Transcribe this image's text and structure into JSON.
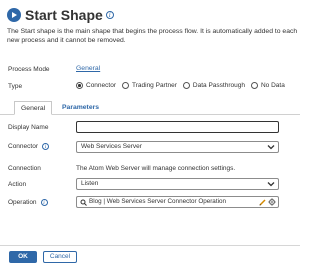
{
  "header": {
    "title": "Start Shape",
    "description_line1": "The Start shape is the main shape that begins the process flow. It is automatically added to each",
    "description_line2": "new process and it cannot be removed."
  },
  "process_mode": {
    "label": "Process Mode",
    "value": "General"
  },
  "type": {
    "label": "Type",
    "options": [
      "Connector",
      "Trading Partner",
      "Data Passthrough",
      "No Data"
    ],
    "selected": "Connector"
  },
  "tabs": [
    {
      "label": "General",
      "active": true
    },
    {
      "label": "Parameters",
      "active": false
    }
  ],
  "form": {
    "display_name": {
      "label": "Display Name",
      "value": ""
    },
    "connector": {
      "label": "Connector",
      "value": "Web Services Server"
    },
    "connection": {
      "label": "Connection",
      "value": "The Atom Web Server will manage connection settings."
    },
    "action": {
      "label": "Action",
      "value": "Listen"
    },
    "operation": {
      "label": "Operation",
      "value": "Blog | Web Services Server Connector Operation"
    }
  },
  "footer": {
    "ok_label": "OK",
    "cancel_label": "Cancel"
  },
  "colors": {
    "accent": "#2f68a8",
    "text": "#333333",
    "border": "#8c8c8c"
  },
  "icons": [
    "start-shape-icon",
    "info-icon",
    "chevron-down-icon",
    "search-icon",
    "pencil-icon",
    "gear-icon"
  ]
}
